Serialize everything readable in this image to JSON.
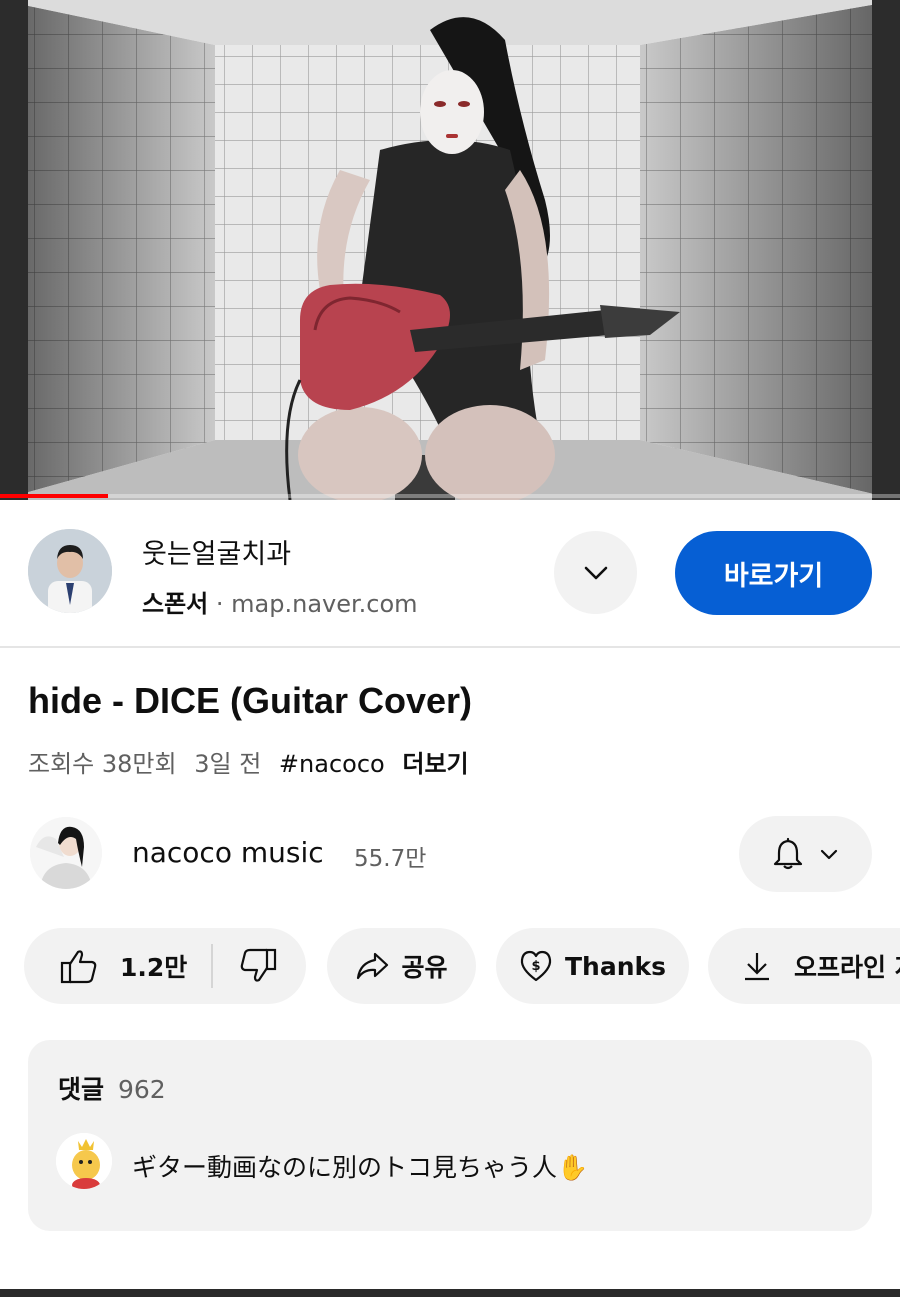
{
  "video": {
    "progress_fraction": 0.12
  },
  "sponsor": {
    "name": "웃는얼굴치과",
    "badge": "스폰서",
    "separator": "·",
    "domain": "map.naver.com",
    "expand_icon": "chevron-down-icon",
    "cta_label": "바로가기",
    "cta_color": "#065fd4"
  },
  "video_info": {
    "title": "hide - DICE (Guitar Cover)",
    "views": "조회수 38만회",
    "age": "3일 전",
    "hashtag": "#nacoco",
    "more_label": "더보기"
  },
  "channel": {
    "name": "nacoco music",
    "subscribers": "55.7만",
    "bell_icon": "bell-icon"
  },
  "actions": {
    "like_count": "1.2만",
    "like_icon": "thumbs-up-icon",
    "dislike_icon": "thumbs-down-icon",
    "share_label": "공유",
    "share_icon": "share-arrow-icon",
    "thanks_label": "Thanks",
    "thanks_icon": "heart-dollar-icon",
    "offline_label": "오프라인 저장",
    "offline_icon": "download-icon"
  },
  "comments": {
    "label": "댓글",
    "count": "962",
    "top_comment": "ギター動画なのに別のトコ見ちゃう人✋"
  }
}
